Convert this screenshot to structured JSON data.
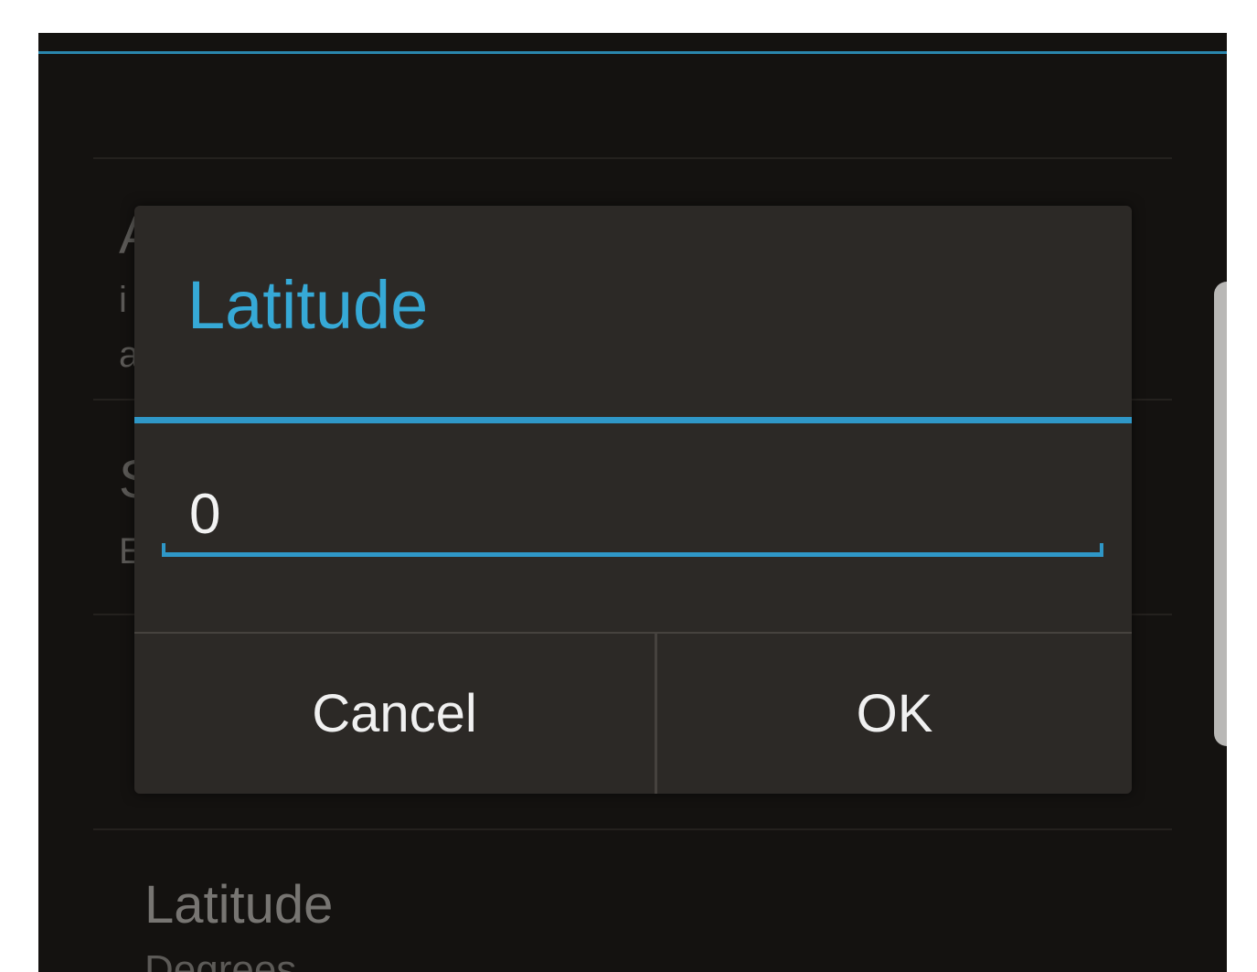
{
  "background": {
    "fragments": [
      "A",
      "i",
      "a",
      "S",
      "E"
    ],
    "list_item_title": "Latitude",
    "list_item_subtitle": "Degrees"
  },
  "dialog": {
    "title": "Latitude",
    "input": {
      "value": "0",
      "placeholder": ""
    },
    "cancel_label": "Cancel",
    "ok_label": "OK"
  },
  "colors": {
    "accent": "#2f97c7",
    "title": "#36a9d6",
    "dialog_background": "#2c2926",
    "screen_background": "#141210"
  }
}
